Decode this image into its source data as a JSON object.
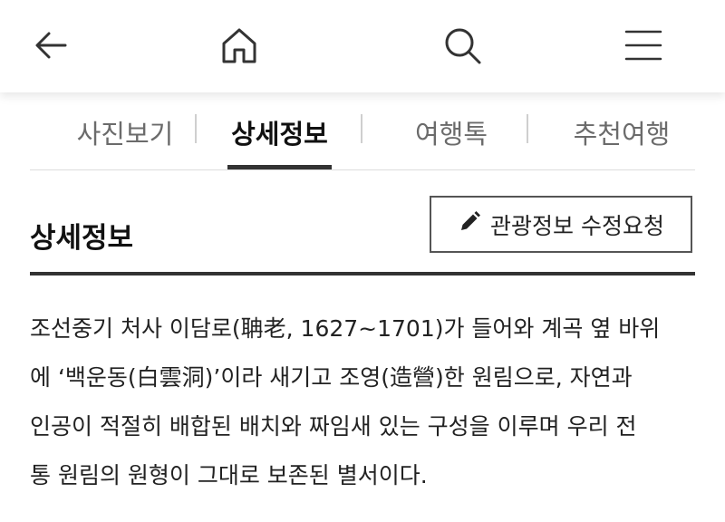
{
  "header": {
    "back_icon": "arrow-left-icon",
    "home_icon": "home-icon",
    "search_icon": "search-icon",
    "menu_icon": "hamburger-menu-icon"
  },
  "tabs": [
    {
      "label": "사진보기",
      "active": false
    },
    {
      "label": "상세정보",
      "active": true
    },
    {
      "label": "여행톡",
      "active": false
    },
    {
      "label": "추천여행",
      "active": false
    }
  ],
  "section": {
    "title": "상세정보",
    "edit_button_label": "관광정보 수정요청",
    "edit_icon": "pencil-icon"
  },
  "description_lines": [
    "조선중기 처사 이담로(聃老, 1627~1701)가 들어와 계곡 옆 바위",
    "에 ‘백운동(白雲洞)’이라 새기고 조영(造營)한 원림으로, 자연과",
    "인공이 적절히 배합된 배치와 짜임새 있는 구성을 이루며 우리 전",
    "통 원림의 원형이 그대로 보존된 별서이다."
  ],
  "colors": {
    "text": "#222222",
    "muted_tab": "#6b6b6b",
    "rule": "#333333"
  }
}
